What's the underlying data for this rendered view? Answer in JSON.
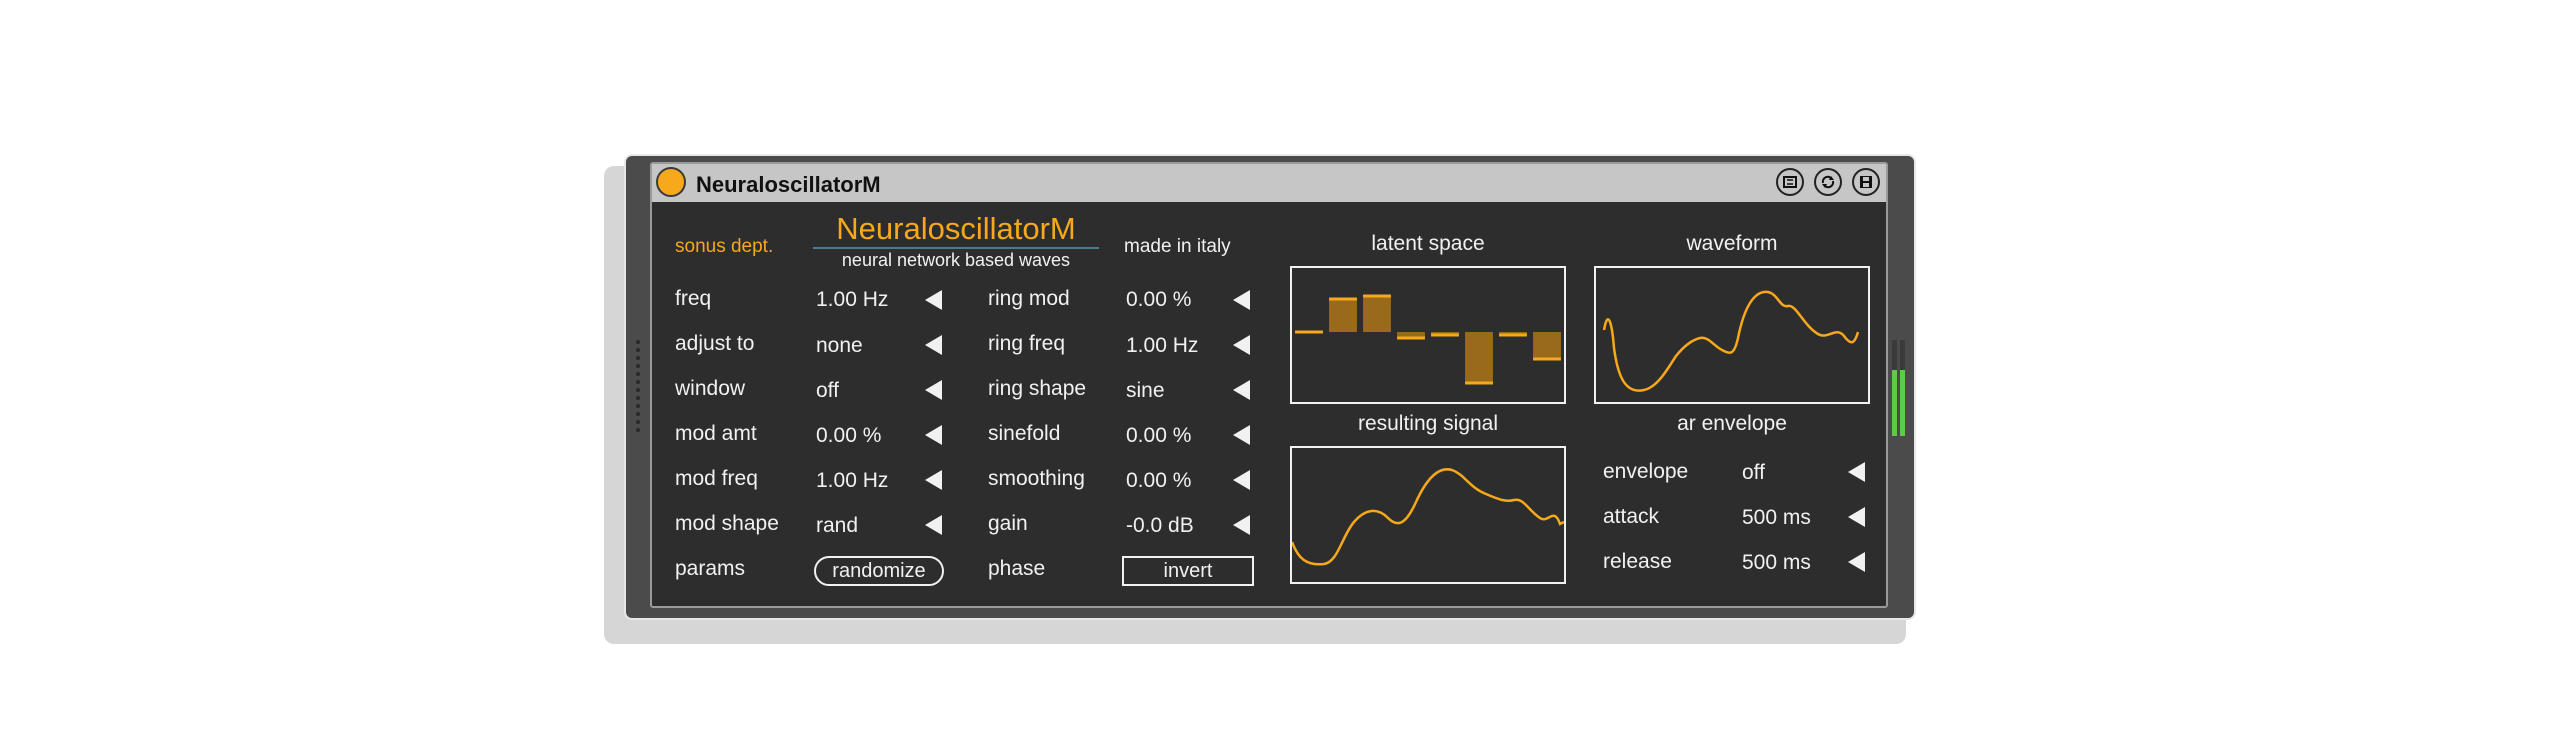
{
  "window": {
    "title": "NeuraloscillatorM"
  },
  "header": {
    "left_label": "sonus dept.",
    "brand": "NeuraloscillatorM",
    "subtitle": "neural network based waves",
    "right_label": "made in italy"
  },
  "left_params": [
    {
      "label": "freq",
      "value": "1.00 Hz"
    },
    {
      "label": "adjust to",
      "value": "none"
    },
    {
      "label": "window",
      "value": "off"
    },
    {
      "label": "mod amt",
      "value": "0.00 %"
    },
    {
      "label": "mod freq",
      "value": "1.00 Hz"
    },
    {
      "label": "mod shape",
      "value": "rand"
    }
  ],
  "right_params": [
    {
      "label": "ring mod",
      "value": "0.00 %"
    },
    {
      "label": "ring freq",
      "value": "1.00 Hz"
    },
    {
      "label": "ring shape",
      "value": "sine"
    },
    {
      "label": "sinefold",
      "value": "0.00 %"
    },
    {
      "label": "smoothing",
      "value": "0.00 %"
    },
    {
      "label": "gain",
      "value": "-0.0 dB"
    }
  ],
  "params_row": {
    "label": "params",
    "button": "randomize"
  },
  "phase_row": {
    "label": "phase",
    "button": "invert"
  },
  "displays": {
    "latent_space": "latent space",
    "waveform": "waveform",
    "resulting_signal": "resulting signal",
    "ar_envelope": "ar envelope"
  },
  "envelope_params": [
    {
      "label": "envelope",
      "value": "off"
    },
    {
      "label": "attack",
      "value": "500 ms"
    },
    {
      "label": "release",
      "value": "500 ms"
    }
  ],
  "latent_values": [
    0,
    0.55,
    0.6,
    -0.1,
    -0.05,
    -0.85,
    -0.05,
    -0.45
  ],
  "colors": {
    "accent": "#f7a81b",
    "panel": "#2d2d2d",
    "text": "#f1f1f1",
    "meter": "#5fc94a"
  },
  "icons": [
    "power-icon",
    "hotswap-icon",
    "refresh-icon",
    "save-icon",
    "arrow-left-icon"
  ]
}
